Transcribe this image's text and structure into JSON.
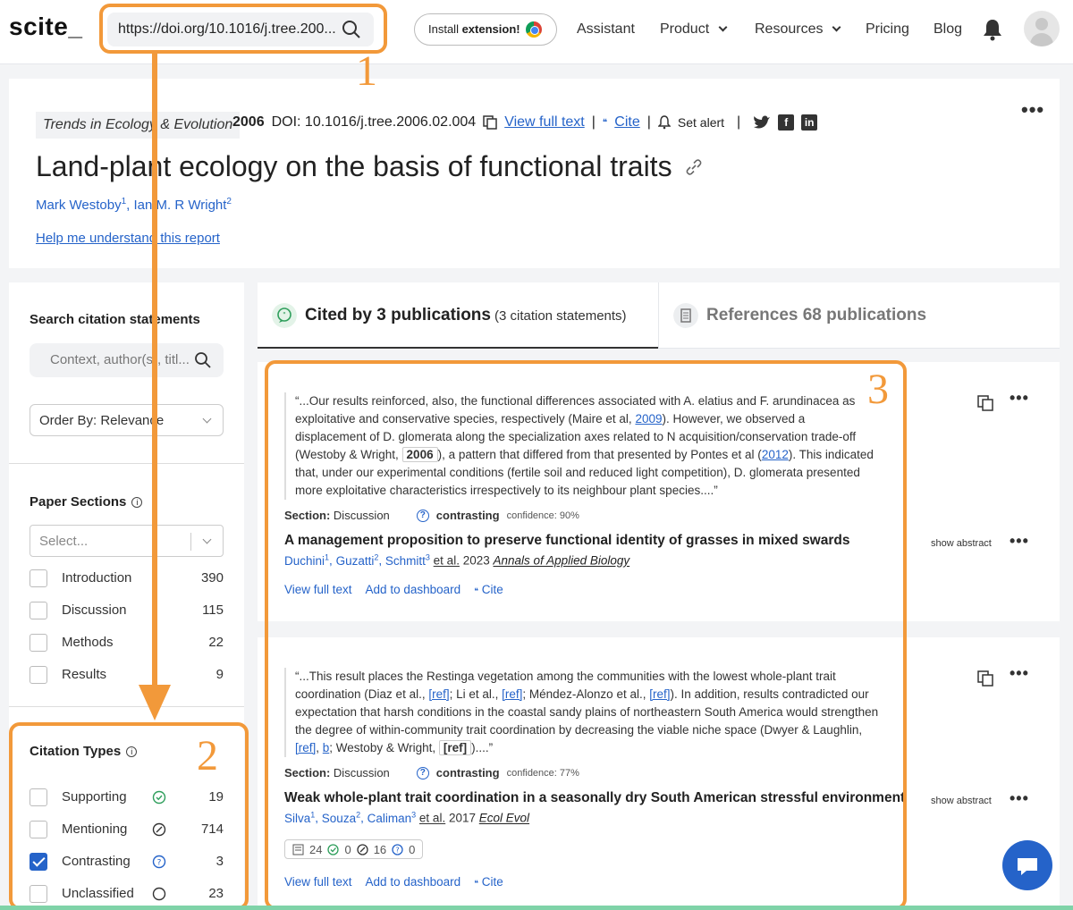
{
  "nav": {
    "logo": "scite_",
    "url": "https://doi.org/10.1016/j.tree.200...",
    "install_prefix": "Install ",
    "install_bold": "extension!",
    "items": [
      "Assistant",
      "Product",
      "Resources",
      "Pricing",
      "Blog"
    ]
  },
  "paper": {
    "journal": "Trends in Ecology & Evolution",
    "year": "2006",
    "doi": "DOI: 10.1016/j.tree.2006.02.004",
    "view_full_text": "View full text",
    "cite": "Cite",
    "set_alert": "Set alert",
    "title": "Land-plant ecology on the basis of functional traits",
    "authors": [
      {
        "name": "Mark Westoby",
        "sup": "1"
      },
      {
        "name": "Ian M. R Wright",
        "sup": "2"
      }
    ],
    "help_link": "Help me understand this report"
  },
  "sidebar": {
    "search_heading": "Search citation statements",
    "search_placeholder": "Context, author(s), titl...",
    "order_by": "Order By: Relevance",
    "sections_heading": "Paper Sections",
    "sections_placeholder": "Select...",
    "sections": [
      {
        "label": "Introduction",
        "count": "390"
      },
      {
        "label": "Discussion",
        "count": "115"
      },
      {
        "label": "Methods",
        "count": "22"
      },
      {
        "label": "Results",
        "count": "9"
      }
    ],
    "types_heading": "Citation Types",
    "types": [
      {
        "label": "Supporting",
        "count": "19",
        "checked": false,
        "icon": "supporting-icon",
        "color": "#2e9e5b"
      },
      {
        "label": "Mentioning",
        "count": "714",
        "checked": false,
        "icon": "mentioning-icon",
        "color": "#333333"
      },
      {
        "label": "Contrasting",
        "count": "3",
        "checked": true,
        "icon": "contrasting-icon",
        "color": "#2563c9"
      },
      {
        "label": "Unclassified",
        "count": "23",
        "checked": false,
        "icon": "unclassified-icon",
        "color": "#333333"
      }
    ]
  },
  "tabs": {
    "cited_by": "Cited by 3 publications",
    "cited_by_sub": "(3 citation statements)",
    "references": "References 68 publications"
  },
  "citations": [
    {
      "quote_parts": [
        "“...Our results reinforced, also, the functional differences associated with A. elatius and F. arundinacea as exploitative and conservative species, respectively (Maire et al, ",
        "2009",
        "). However, we observed a displacement of D. glomerata along the specialization axes related to N acquisition/conservation trade-off (Westoby & Wright, ",
        "2006",
        "), a pattern that differed from that presented by Pontes et al (",
        "2012",
        "). This indicated that, under our experimental conditions (fertile soil and reduced light competition), D. glomerata presented more exploitative characteristics irrespectively to its neighbour plant species....”"
      ],
      "section_label": "Section:",
      "section": "Discussion",
      "type": "contrasting",
      "confidence": "confidence: 90%",
      "title": "A management proposition to preserve functional identity of grasses in mixed swards",
      "authors": [
        {
          "name": "Duchini",
          "sup": "1"
        },
        {
          "name": "Guzatti",
          "sup": "2"
        },
        {
          "name": "Schmitt",
          "sup": "3"
        }
      ],
      "et_al": "et al.",
      "year": "2023",
      "journal": "Annals of Applied Biology",
      "show_abstract": "show abstract",
      "actions": [
        "View full text",
        "Add to dashboard",
        "Cite"
      ]
    },
    {
      "quote_parts": [
        "“...This result places the Restinga vegetation among the communities with the lowest whole-plant trait coordination (Diaz et al., ",
        "[ref]",
        "; Li et al., ",
        "[ref]",
        "; Méndez-Alonzo et al., ",
        "[ref]",
        "). In addition, results contradicted our expectation that harsh conditions in the coastal sandy plains of northeastern South America would strengthen the degree of within-community trait coordination by decreasing the viable niche space (Dwyer & Laughlin, ",
        "[ref]",
        ", ",
        "b",
        "; Westoby & Wright, ",
        "[ref]",
        ")....”"
      ],
      "section_label": "Section:",
      "section": "Discussion",
      "type": "contrasting",
      "confidence": "confidence: 77%",
      "title": "Weak whole-plant trait coordination in a seasonally dry South American stressful environment",
      "authors": [
        {
          "name": "Silva",
          "sup": "1"
        },
        {
          "name": "Souza",
          "sup": "2"
        },
        {
          "name": "Caliman",
          "sup": "3"
        }
      ],
      "et_al": "et al.",
      "year": "2017",
      "journal": "Ecol Evol",
      "show_abstract": "show abstract",
      "stats": [
        "24",
        "0",
        "16",
        "0"
      ],
      "actions": [
        "View full text",
        "Add to dashboard",
        "Cite"
      ]
    }
  ],
  "annotations": [
    "1",
    "2",
    "3"
  ],
  "colors": {
    "accent": "#2563c9",
    "highlight": "#f2993a",
    "supporting": "#2e9e5b"
  }
}
